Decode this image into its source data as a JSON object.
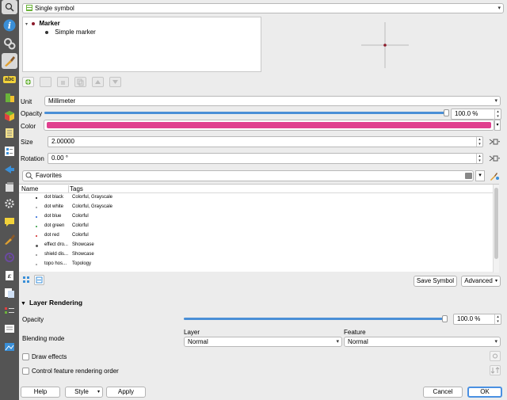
{
  "sidebar": {
    "icons": [
      "search-icon",
      "info-icon",
      "source-icon",
      "symbology-icon",
      "labels-icon",
      "3d-view-icon",
      "diagrams-icon",
      "fields-icon",
      "attributes-form-icon",
      "joins-icon",
      "auxiliary-storage-icon",
      "actions-icon",
      "display-icon",
      "rendering-icon",
      "temporal-icon",
      "variables-icon",
      "metadata-icon",
      "dependencies-icon",
      "legend-icon",
      "qgis-server-icon",
      "digitizing-icon"
    ],
    "abc_label": "abc"
  },
  "renderer": {
    "selected": "Single symbol"
  },
  "symbol_tree": {
    "root": "Marker",
    "child": "Simple marker"
  },
  "unit": {
    "label": "Unit",
    "value": "Millimeter"
  },
  "opacity": {
    "label": "Opacity",
    "value": "100.0 %",
    "level": 1.0
  },
  "color": {
    "label": "Color",
    "swatch": "#e0408f"
  },
  "size": {
    "label": "Size",
    "value": "2.00000"
  },
  "rotation": {
    "label": "Rotation",
    "value": "0.00 °"
  },
  "library": {
    "search_value": "Favorites",
    "col_name": "Name",
    "col_tags": "Tags",
    "rows": [
      {
        "name": "dot  black",
        "tags": "Colorful, Grayscale"
      },
      {
        "name": "dot  white",
        "tags": "Colorful, Grayscale"
      },
      {
        "name": "dot blue",
        "tags": "Colorful"
      },
      {
        "name": "dot green",
        "tags": "Colorful"
      },
      {
        "name": "dot red",
        "tags": "Colorful"
      },
      {
        "name": "effect dro...",
        "tags": "Showcase"
      },
      {
        "name": "shield dis...",
        "tags": "Showcase"
      },
      {
        "name": "topo hos...",
        "tags": "Topology"
      }
    ],
    "save_symbol": "Save Symbol",
    "advanced": "Advanced"
  },
  "layer_rendering": {
    "title": "Layer Rendering",
    "opacity_label": "Opacity",
    "opacity_value": "100.0 %",
    "opacity_level": 1.0,
    "blending_label": "Blending mode",
    "layer_label": "Layer",
    "feature_label": "Feature",
    "layer_value": "Normal",
    "feature_value": "Normal",
    "draw_effects": "Draw effects",
    "control_order": "Control feature rendering order"
  },
  "footer": {
    "help": "Help",
    "style": "Style",
    "apply": "Apply",
    "cancel": "Cancel",
    "ok": "OK"
  },
  "colors": {
    "accent": "#4a8fd6",
    "ok_border": "#4a90e2",
    "marker": "#8b1a2a"
  }
}
